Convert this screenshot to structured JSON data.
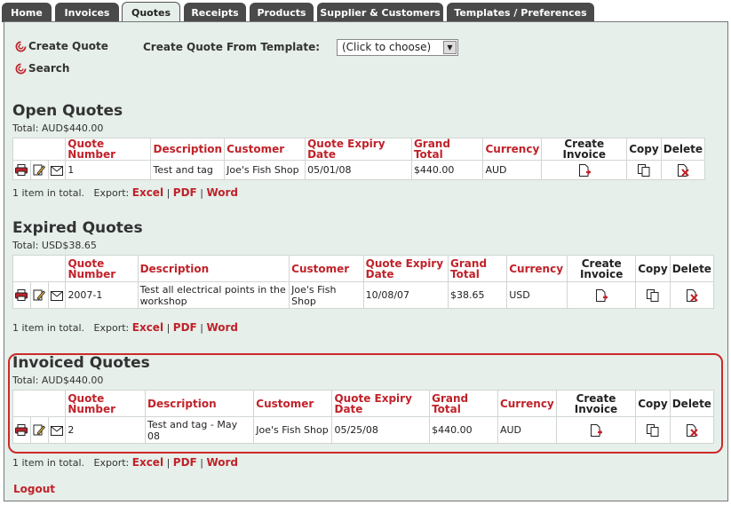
{
  "tabs": [
    {
      "label": "Home",
      "active": false
    },
    {
      "label": "Invoices",
      "active": false
    },
    {
      "label": "Quotes",
      "active": true
    },
    {
      "label": "Receipts",
      "active": false
    },
    {
      "label": "Products",
      "active": false
    },
    {
      "label": "Supplier & Customers",
      "active": false
    },
    {
      "label": "Templates / Preferences",
      "active": false
    }
  ],
  "actions": {
    "create_quote": "Create Quote",
    "search": "Search",
    "template_label": "Create Quote From Template:",
    "template_select": "(Click to choose)"
  },
  "open": {
    "title": "Open Quotes",
    "total": "Total: AUD$440.00",
    "headers": [
      "Quote Number",
      "Description",
      "Customer",
      "Quote Expiry Date",
      "Grand Total",
      "Currency",
      "Create Invoice",
      "Copy",
      "Delete"
    ],
    "rows": [
      {
        "number": "1",
        "description": "Test and tag",
        "customer": "Joe's Fish Shop",
        "expiry": "05/01/08",
        "total": "$440.00",
        "currency": "AUD"
      }
    ],
    "count": "1 item in total."
  },
  "expired": {
    "title": "Expired Quotes",
    "total": "Total: USD$38.65",
    "headers": [
      "Quote Number",
      "Description",
      "Customer",
      "Quote Expiry Date",
      "Grand Total",
      "Currency",
      "Create Invoice",
      "Copy",
      "Delete"
    ],
    "rows": [
      {
        "number": "2007-1",
        "description": "Test all electrical points in the workshop",
        "customer": "Joe's Fish Shop",
        "expiry": "10/08/07",
        "total": "$38.65",
        "currency": "USD"
      }
    ],
    "count": "1 item in total."
  },
  "invoiced": {
    "title": "Invoiced Quotes",
    "total": "Total: AUD$440.00",
    "headers": [
      "Quote Number",
      "Description",
      "Customer",
      "Quote Expiry Date",
      "Grand Total",
      "Currency",
      "Create Invoice",
      "Copy",
      "Delete"
    ],
    "rows": [
      {
        "number": "2",
        "description": "Test and tag - May 08",
        "customer": "Joe's Fish Shop",
        "expiry": "05/25/08",
        "total": "$440.00",
        "currency": "AUD"
      }
    ],
    "count": "1 item in total."
  },
  "export": {
    "label": "Export:",
    "excel": "Excel",
    "pdf": "PDF",
    "word": "Word",
    "sep": "|"
  },
  "logout": "Logout",
  "colors": {
    "accent": "#c0222a",
    "tab_bg": "#4a4a4a",
    "panel_bg": "#e6efea"
  }
}
